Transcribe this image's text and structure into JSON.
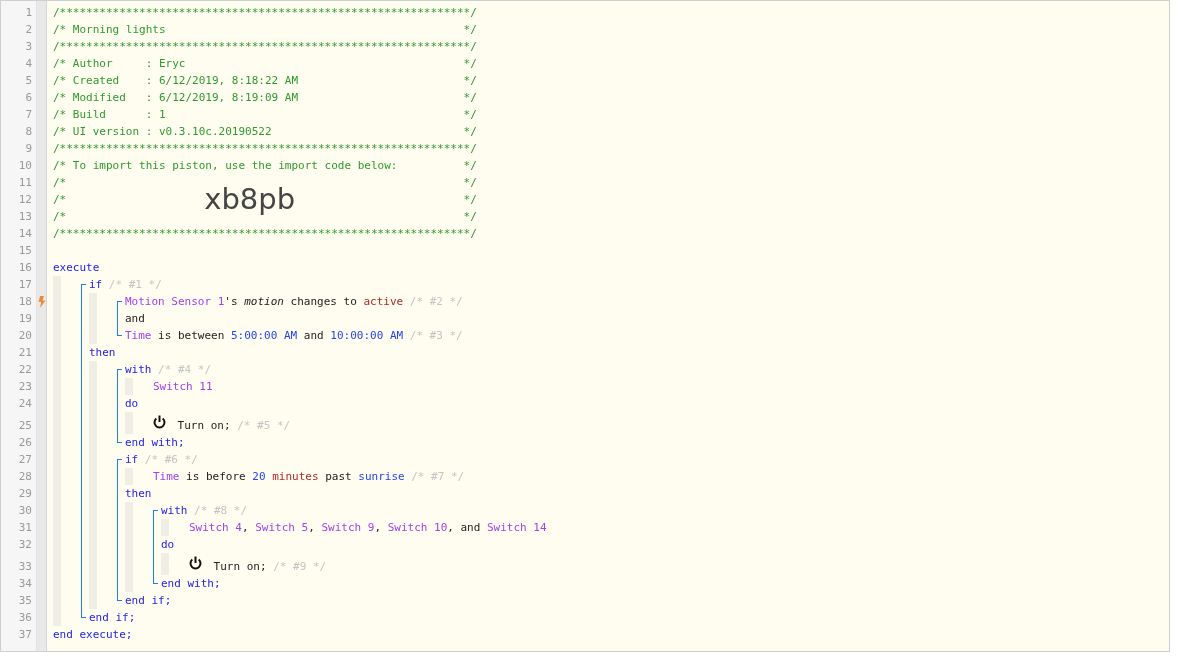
{
  "gutter": [
    {
      "number": "1",
      "trigger": false
    },
    {
      "number": "2",
      "trigger": false
    },
    {
      "number": "3",
      "trigger": false
    },
    {
      "number": "4",
      "trigger": false
    },
    {
      "number": "5",
      "trigger": false
    },
    {
      "number": "6",
      "trigger": false
    },
    {
      "number": "7",
      "trigger": false
    },
    {
      "number": "8",
      "trigger": false
    },
    {
      "number": "9",
      "trigger": false
    },
    {
      "number": "10",
      "trigger": false
    },
    {
      "number": "11",
      "trigger": false
    },
    {
      "number": "12",
      "trigger": false
    },
    {
      "number": "13",
      "trigger": false
    },
    {
      "number": "14",
      "trigger": false
    },
    {
      "number": "15",
      "trigger": false
    },
    {
      "number": "16",
      "trigger": false
    },
    {
      "number": "17",
      "trigger": false
    },
    {
      "number": "18",
      "trigger": true
    },
    {
      "number": "19",
      "trigger": false
    },
    {
      "number": "20",
      "trigger": false
    },
    {
      "number": "21",
      "trigger": false
    },
    {
      "number": "22",
      "trigger": false
    },
    {
      "number": "23",
      "trigger": false
    },
    {
      "number": "24",
      "trigger": false
    },
    {
      "number": "25",
      "trigger": false
    },
    {
      "number": "26",
      "trigger": false
    },
    {
      "number": "27",
      "trigger": false
    },
    {
      "number": "28",
      "trigger": false
    },
    {
      "number": "29",
      "trigger": false
    },
    {
      "number": "30",
      "trigger": false
    },
    {
      "number": "31",
      "trigger": false
    },
    {
      "number": "32",
      "trigger": false
    },
    {
      "number": "33",
      "trigger": false
    },
    {
      "number": "34",
      "trigger": false
    },
    {
      "number": "35",
      "trigger": false
    },
    {
      "number": "36",
      "trigger": false
    },
    {
      "number": "37",
      "trigger": false
    }
  ],
  "header": [
    {
      "tokens": [
        {
          "kind": "comment",
          "text": "/**************************************************************/"
        }
      ]
    },
    {
      "tokens": [
        {
          "kind": "comment",
          "text": "/* Morning lights"
        },
        {
          "kind": "comment-end",
          "text": "*/"
        }
      ]
    },
    {
      "tokens": [
        {
          "kind": "comment",
          "text": "/**************************************************************/"
        }
      ]
    },
    {
      "tokens": [
        {
          "kind": "comment",
          "text": "/* Author     : Eryc"
        },
        {
          "kind": "comment-end",
          "text": "*/"
        }
      ]
    },
    {
      "tokens": [
        {
          "kind": "comment",
          "text": "/* Created    : 6/12/2019, 8:18:22 AM"
        },
        {
          "kind": "comment-end",
          "text": "*/"
        }
      ]
    },
    {
      "tokens": [
        {
          "kind": "comment",
          "text": "/* Modified   : 6/12/2019, 8:19:09 AM"
        },
        {
          "kind": "comment-end",
          "text": "*/"
        }
      ]
    },
    {
      "tokens": [
        {
          "kind": "comment",
          "text": "/* Build      : 1"
        },
        {
          "kind": "comment-end",
          "text": "*/"
        }
      ]
    },
    {
      "tokens": [
        {
          "kind": "comment",
          "text": "/* UI version : v0.3.10c.20190522"
        },
        {
          "kind": "comment-end",
          "text": "*/"
        }
      ]
    },
    {
      "tokens": [
        {
          "kind": "comment",
          "text": "/**************************************************************/"
        }
      ]
    },
    {
      "tokens": [
        {
          "kind": "comment",
          "text": "/* To import this piston, use the import code below:"
        },
        {
          "kind": "comment-end",
          "text": "*/"
        }
      ]
    },
    {
      "tokens": [
        {
          "kind": "comment",
          "text": "/*"
        },
        {
          "kind": "comment-end",
          "text": "*/"
        }
      ]
    },
    {
      "tokens": [
        {
          "kind": "comment",
          "text": "/*"
        },
        {
          "kind": "import-code",
          "text": "xb8pb"
        },
        {
          "kind": "comment-end",
          "text": "*/"
        }
      ]
    },
    {
      "tokens": [
        {
          "kind": "comment",
          "text": "/*"
        },
        {
          "kind": "comment-end",
          "text": "*/"
        }
      ]
    },
    {
      "tokens": [
        {
          "kind": "comment",
          "text": "/**************************************************************/"
        }
      ]
    }
  ],
  "program": [
    {
      "kind": "line",
      "tokens": [
        {
          "kind": "keyword",
          "text": "execute"
        }
      ],
      "children": [
        {
          "kind": "block",
          "lines": [
            {
              "kind": "line",
              "tokens": [
                {
                  "kind": "keyword",
                  "text": "if"
                },
                {
                  "kind": "note",
                  "text": "/* #1 */"
                }
              ],
              "children": [
                {
                  "kind": "block",
                  "lines": [
                    {
                      "kind": "line",
                      "tokens": [
                        {
                          "kind": "device",
                          "text": "Motion Sensor 1"
                        },
                        {
                          "kind": "plain",
                          "text": "'s",
                          "attach": true
                        },
                        {
                          "kind": "attribute",
                          "text": "motion"
                        },
                        {
                          "kind": "plain",
                          "text": "changes to"
                        },
                        {
                          "kind": "literal",
                          "text": "active"
                        },
                        {
                          "kind": "note",
                          "text": "/* #2 */"
                        }
                      ]
                    },
                    {
                      "kind": "line",
                      "tokens": [
                        {
                          "kind": "plain",
                          "text": "and"
                        }
                      ]
                    },
                    {
                      "kind": "line",
                      "tokens": [
                        {
                          "kind": "device",
                          "text": "Time"
                        },
                        {
                          "kind": "plain",
                          "text": "is between"
                        },
                        {
                          "kind": "value",
                          "text": "5:00:00 AM"
                        },
                        {
                          "kind": "plain",
                          "text": "and"
                        },
                        {
                          "kind": "value",
                          "text": "10:00:00 AM"
                        },
                        {
                          "kind": "note",
                          "text": "/* #3 */"
                        }
                      ]
                    }
                  ]
                }
              ]
            },
            {
              "kind": "line",
              "tokens": [
                {
                  "kind": "keyword",
                  "text": "then"
                }
              ],
              "children": [
                {
                  "kind": "block",
                  "lines": [
                    {
                      "kind": "line",
                      "tokens": [
                        {
                          "kind": "keyword",
                          "text": "with"
                        },
                        {
                          "kind": "note",
                          "text": "/* #4 */"
                        }
                      ],
                      "children": [
                        {
                          "kind": "line",
                          "tokens": [
                            {
                              "kind": "device",
                              "text": "Switch 11"
                            }
                          ]
                        }
                      ]
                    },
                    {
                      "kind": "line",
                      "tokens": [
                        {
                          "kind": "keyword",
                          "text": "do"
                        }
                      ],
                      "children": [
                        {
                          "kind": "line",
                          "tokens": [
                            {
                              "kind": "icon"
                            },
                            {
                              "kind": "plain",
                              "text": "Turn on;"
                            },
                            {
                              "kind": "note",
                              "text": "/* #5 */"
                            }
                          ]
                        }
                      ]
                    },
                    {
                      "kind": "line",
                      "tokens": [
                        {
                          "kind": "keyword",
                          "text": "end with;"
                        }
                      ]
                    }
                  ]
                },
                {
                  "kind": "block",
                  "lines": [
                    {
                      "kind": "line",
                      "tokens": [
                        {
                          "kind": "keyword",
                          "text": "if"
                        },
                        {
                          "kind": "note",
                          "text": "/* #6 */"
                        }
                      ],
                      "children": [
                        {
                          "kind": "line",
                          "tokens": [
                            {
                              "kind": "device",
                              "text": "Time"
                            },
                            {
                              "kind": "plain",
                              "text": "is before"
                            },
                            {
                              "kind": "value",
                              "text": "20"
                            },
                            {
                              "kind": "literal",
                              "text": "minutes"
                            },
                            {
                              "kind": "plain",
                              "text": "past"
                            },
                            {
                              "kind": "value",
                              "text": "sunrise"
                            },
                            {
                              "kind": "note",
                              "text": "/* #7 */"
                            }
                          ]
                        }
                      ]
                    },
                    {
                      "kind": "line",
                      "tokens": [
                        {
                          "kind": "keyword",
                          "text": "then"
                        }
                      ],
                      "children": [
                        {
                          "kind": "block",
                          "lines": [
                            {
                              "kind": "line",
                              "tokens": [
                                {
                                  "kind": "keyword",
                                  "text": "with"
                                },
                                {
                                  "kind": "note",
                                  "text": "/* #8 */"
                                }
                              ],
                              "children": [
                                {
                                  "kind": "line",
                                  "tokens": [
                                    {
                                      "kind": "device",
                                      "text": "Switch 4"
                                    },
                                    {
                                      "kind": "plain",
                                      "text": ",",
                                      "attach": true
                                    },
                                    {
                                      "kind": "device",
                                      "text": "Switch 5"
                                    },
                                    {
                                      "kind": "plain",
                                      "text": ",",
                                      "attach": true
                                    },
                                    {
                                      "kind": "device",
                                      "text": "Switch 9"
                                    },
                                    {
                                      "kind": "plain",
                                      "text": ",",
                                      "attach": true
                                    },
                                    {
                                      "kind": "device",
                                      "text": "Switch 10"
                                    },
                                    {
                                      "kind": "plain",
                                      "text": ",",
                                      "attach": true
                                    },
                                    {
                                      "kind": "plain",
                                      "text": "and"
                                    },
                                    {
                                      "kind": "device",
                                      "text": "Switch 14"
                                    }
                                  ]
                                }
                              ]
                            },
                            {
                              "kind": "line",
                              "tokens": [
                                {
                                  "kind": "keyword",
                                  "text": "do"
                                }
                              ],
                              "children": [
                                {
                                  "kind": "line",
                                  "tokens": [
                                    {
                                      "kind": "icon"
                                    },
                                    {
                                      "kind": "plain",
                                      "text": "Turn on;"
                                    },
                                    {
                                      "kind": "note",
                                      "text": "/* #9 */"
                                    }
                                  ]
                                }
                              ]
                            },
                            {
                              "kind": "line",
                              "tokens": [
                                {
                                  "kind": "keyword",
                                  "text": "end with;"
                                }
                              ]
                            }
                          ]
                        }
                      ]
                    },
                    {
                      "kind": "line",
                      "tokens": [
                        {
                          "kind": "keyword",
                          "text": "end if;"
                        }
                      ]
                    }
                  ]
                }
              ]
            },
            {
              "kind": "line",
              "tokens": [
                {
                  "kind": "keyword",
                  "text": "end if;"
                }
              ]
            }
          ]
        }
      ]
    },
    {
      "kind": "line",
      "tokens": [
        {
          "kind": "keyword",
          "text": "end execute;"
        }
      ]
    }
  ]
}
